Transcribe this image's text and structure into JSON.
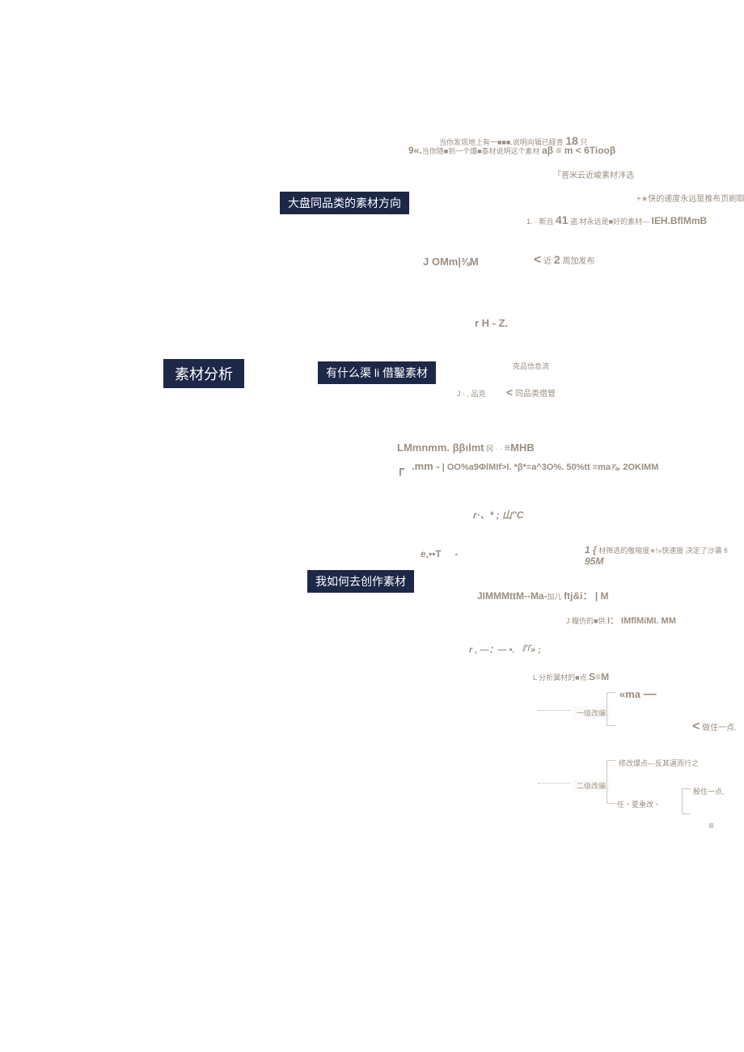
{
  "root": {
    "title": "素材分析"
  },
  "nodes": {
    "direction": "大盘同品类的素材方向",
    "channels": "有什么渠 li 借鑿素材",
    "how": "我如何去创作素材"
  },
  "top": {
    "line1a": "当你发现地上有一■■■.说明向辑已経青 ",
    "line1b": "18",
    "line1c": " 只",
    "line2a": "9«.",
    "line2b": "当你随■到一个爆■泰材说明这个素材 ",
    "line2c": "aβ ≡ m < 6Tiooβ",
    "sub1": "「菩米云近峻素材泮选",
    "sub2": "+∗快的递度永远是推布页刷取",
    "sub3a": "1. · 新且 ",
    "sub3b": "41",
    "sub3c": " 盗.材永远是■好的素材— ",
    "sub3d": "IEH.BflMmB",
    "filter1": "J OMm|⅜M",
    "filter2a": "近 ",
    "filter2b": "2",
    "filter2c": " 周加发布",
    "hz": "r H - Z."
  },
  "mid": {
    "ch1": "克品信息流",
    "ch2a": "J · , 品克",
    "ch2b": "同品类借管",
    "l1": "LMmnmm. ββılmt",
    "l1b": " 冈 · · ",
    "l1c": "≡MHB",
    "l2a": ".mm -",
    "l2b": " | OO%a9ΦlMIf>I. *β*≡a^3O%. 50%tt ≡ma⅞. 2OKIMM",
    "l3": "r·、* ; 山\"C",
    "l4a": "e,••T",
    "l4b": "-",
    "l5a": "1 {",
    "l5b": " 材筛选的敬嗖度∗!»快速度 决定了沙袭 fi",
    "l5c": "95M"
  },
  "how": {
    "h1a": "JIMMMttM--Ma-",
    "h1b": "加儿 ",
    "h1c": "ftj&i： | M",
    "h2a": "J 糧仿的■供.",
    "h2b": "I： IMflMiMI. MM",
    "h3": "r , —：— •. 『「» ;",
    "h4a": "L 分析翼材的■点.",
    "h4b": "S≡M"
  },
  "edits": {
    "lvl1": "一级改编",
    "lvl2": "二级改编",
    "ma": "«ma",
    "dash": "—",
    "keep1": "做住一点.",
    "mod": "修改爆点—反其邁而行之",
    "ren": "任・夏重改・",
    "keep2": "殷住一点,",
    "bottom": "≡"
  },
  "glyphs": {
    "lt": "<",
    "corner": "┌"
  }
}
